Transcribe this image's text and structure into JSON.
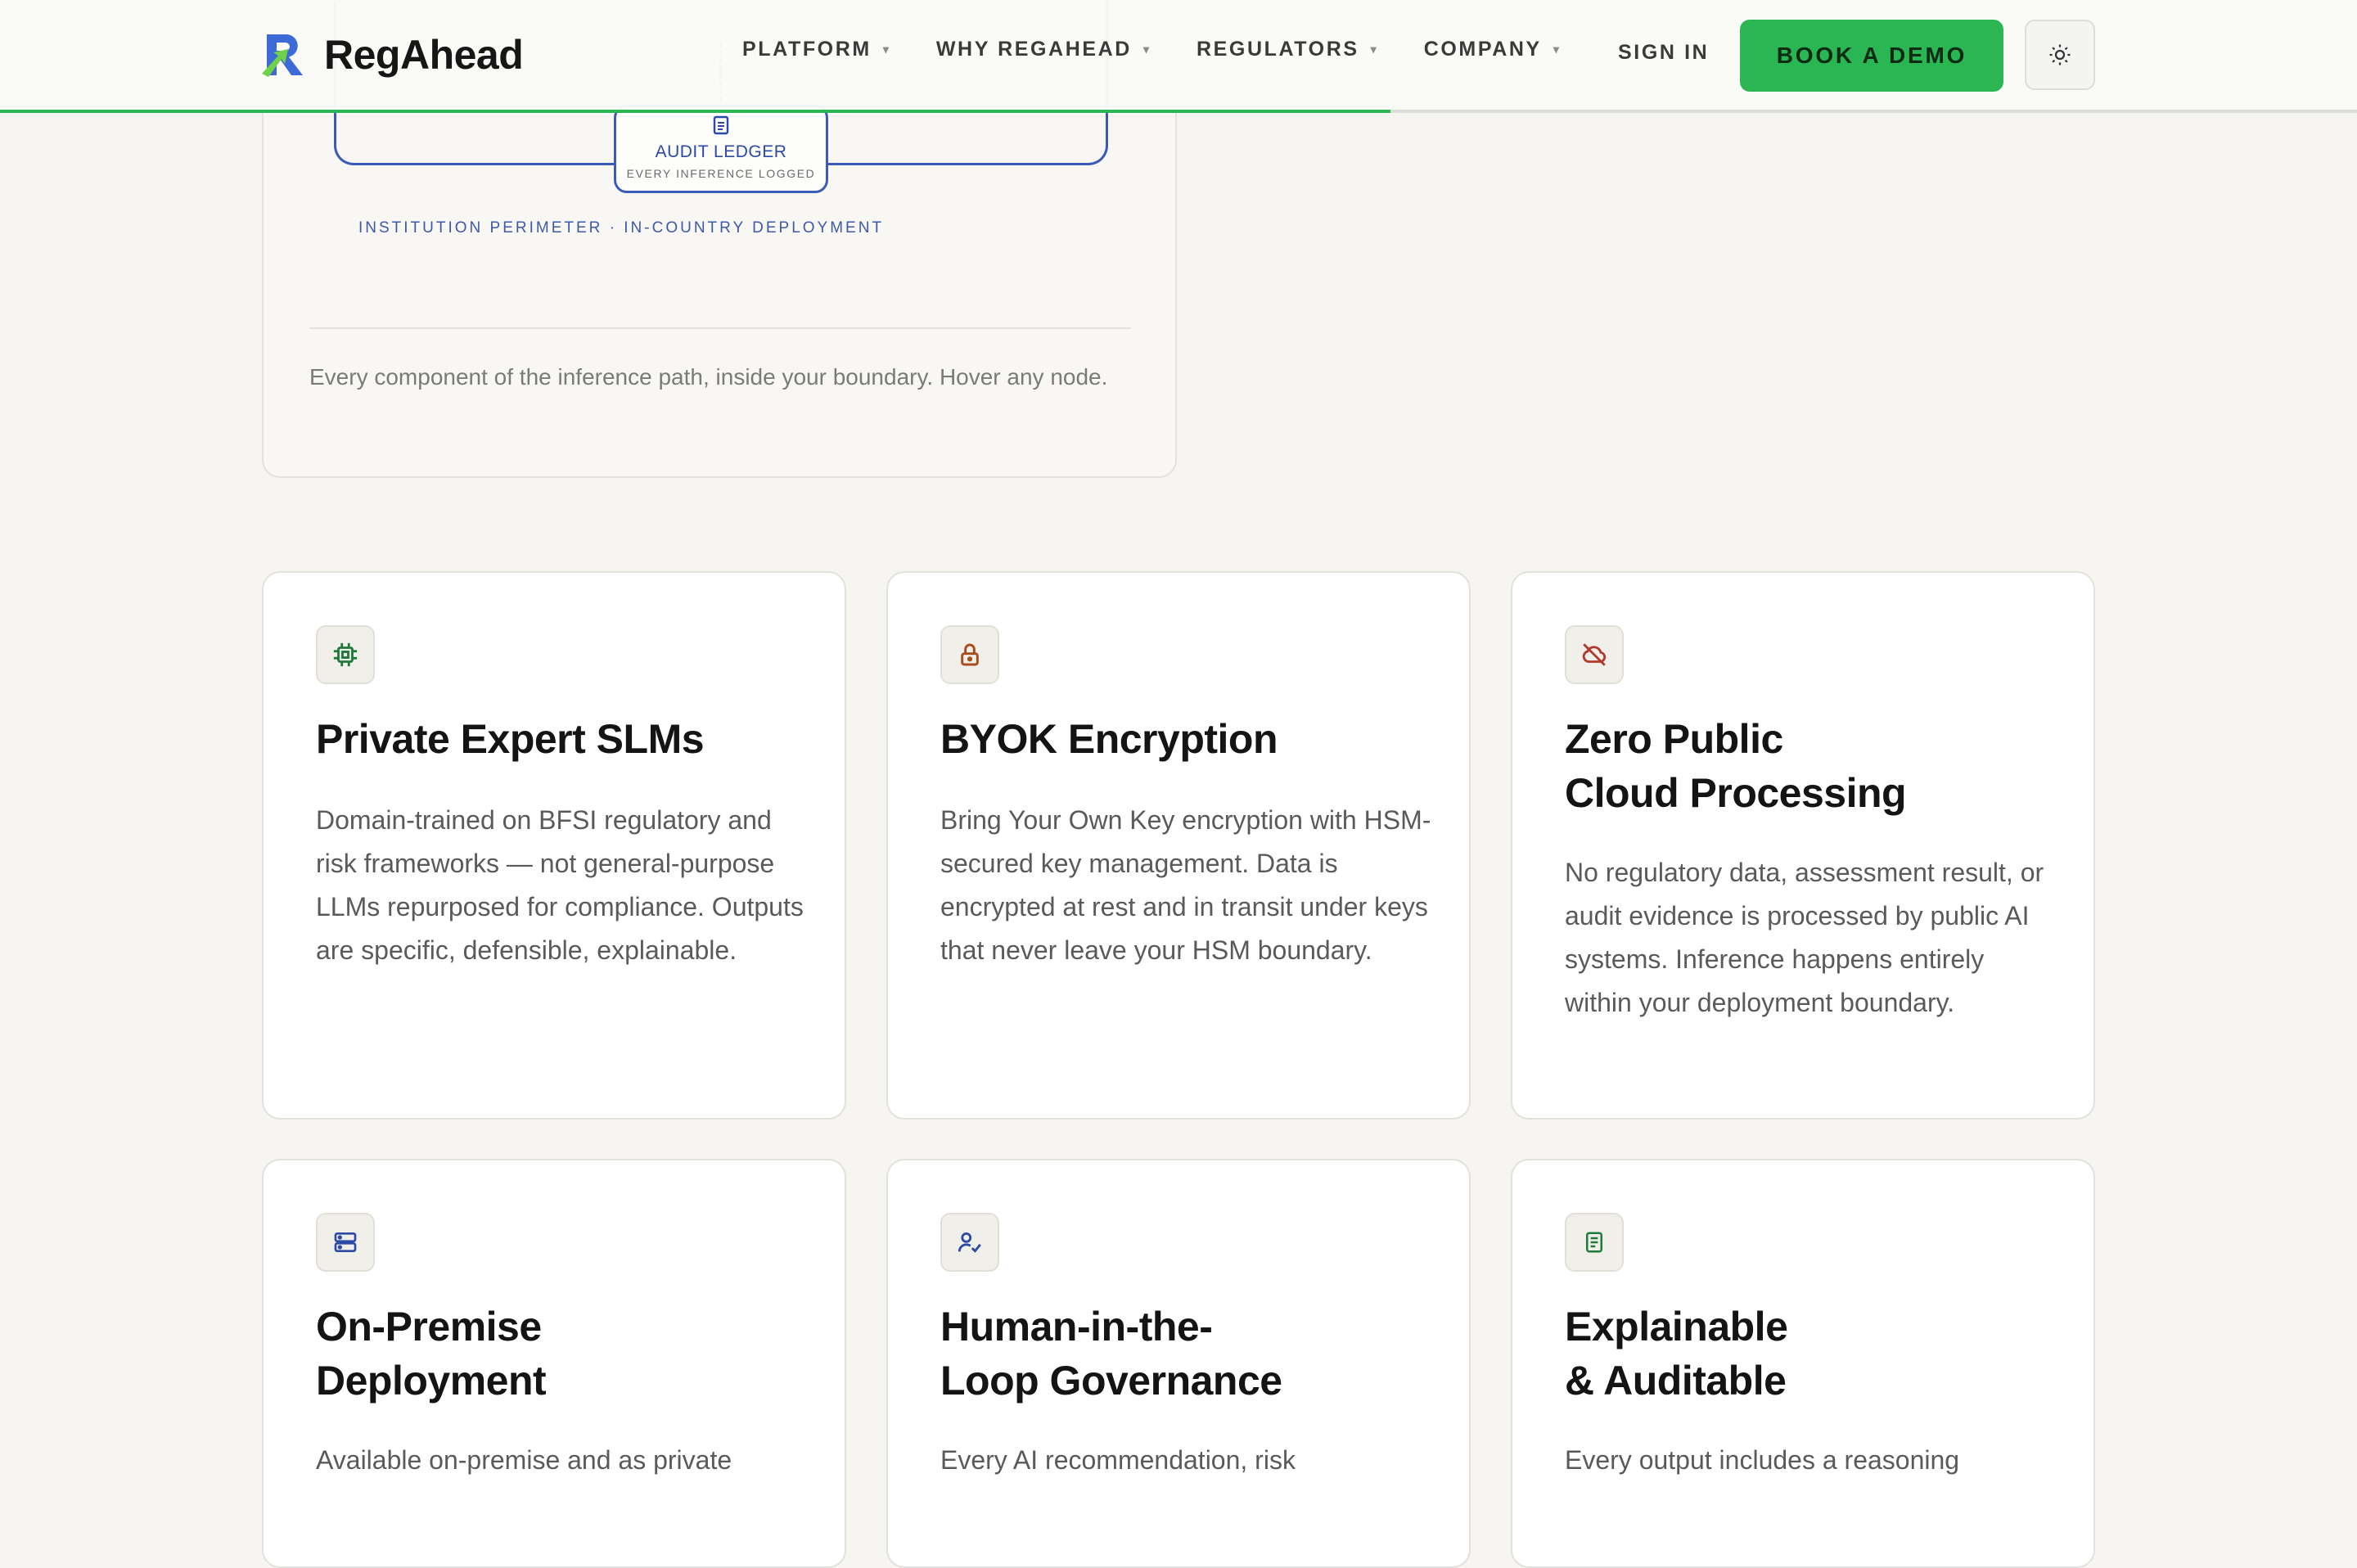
{
  "header": {
    "logo_text": "RegAhead",
    "nav": [
      {
        "label": "PLATFORM"
      },
      {
        "label": "WHY REGAHEAD"
      },
      {
        "label": "REGULATORS"
      },
      {
        "label": "COMPANY"
      }
    ],
    "sign_in": "SIGN IN",
    "demo_button": "BOOK A DEMO",
    "scroll_progress": 0.59,
    "colors": {
      "accent": "#2bb654",
      "diagram_blue": "#3a5bb7"
    }
  },
  "diagram": {
    "node_title": "AUDIT LEDGER",
    "node_subtitle": "EVERY INFERENCE LOGGED",
    "perimeter_label": "INSTITUTION PERIMETER · IN-COUNTRY DEPLOYMENT",
    "caption": "Every component of the inference path, inside your boundary. Hover any node."
  },
  "features": [
    {
      "icon": "chip-icon",
      "title_line1": "Private Expert SLMs",
      "title_line2": "",
      "desc": "Domain-trained on BFSI regulatory and risk frameworks — not general-purpose LLMs repurposed for compliance. Outputs are specific, defensible, explainable."
    },
    {
      "icon": "lock-icon",
      "title_line1": "BYOK Encryption",
      "title_line2": "",
      "desc": "Bring Your Own Key encryption with HSM-secured key management. Data is encrypted at rest and in transit under keys that never leave your HSM boundary."
    },
    {
      "icon": "cloud-off-icon",
      "title_line1": "Zero Public",
      "title_line2": "Cloud Processing",
      "desc": "No regulatory data, assessment result, or audit evidence is processed by public AI systems. Inference happens entirely within your deployment boundary."
    },
    {
      "icon": "server-icon",
      "title_line1": "On-Premise",
      "title_line2": "Deployment",
      "desc": "Available on-premise and as private"
    },
    {
      "icon": "user-check-icon",
      "title_line1": "Human-in-the-",
      "title_line2": "Loop Governance",
      "desc": "Every AI recommendation, risk"
    },
    {
      "icon": "document-icon",
      "title_line1": "Explainable",
      "title_line2": "& Auditable",
      "desc": "Every output includes a reasoning"
    }
  ]
}
